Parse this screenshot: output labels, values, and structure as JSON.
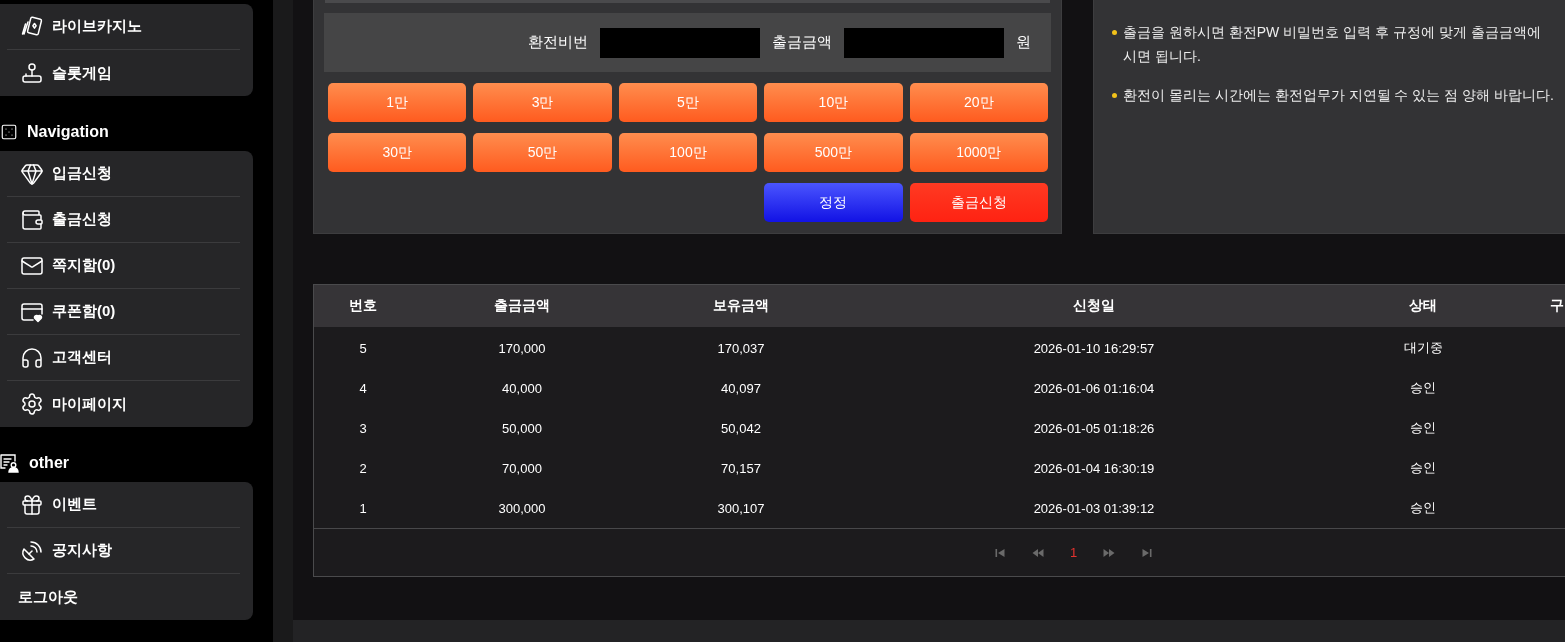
{
  "sidebar": {
    "sections": [
      {
        "items": [
          "라이브카지노",
          "슬롯게임"
        ]
      },
      {
        "title": "Navigation",
        "items": [
          "입금신청",
          "출금신청",
          "쪽지함(0)",
          "쿠폰함(0)",
          "고객센터",
          "마이페이지"
        ]
      },
      {
        "title": "other",
        "items": [
          "이벤트",
          "공지사항",
          "로그아웃"
        ]
      }
    ]
  },
  "withdraw_form": {
    "fields": [
      {
        "label": "환전비번"
      },
      {
        "label": "출금금액",
        "unit": "원"
      }
    ],
    "amount_buttons": [
      "1만",
      "3만",
      "5만",
      "10만",
      "20만",
      "30만",
      "50만",
      "100만",
      "500만",
      "1000만"
    ],
    "actions": [
      {
        "label": "정정",
        "kind": "reset"
      },
      {
        "label": "출금신청",
        "kind": "submit"
      }
    ]
  },
  "notices": [
    "출금을 원하시면 환전PW 비밀번호 입력 후 규정에 맞게 출금금액에\n시면 됩니다.",
    "환전이 몰리는 시간에는 환전업무가 지연될 수 있는 점 양해 바랍니다."
  ],
  "history_table": {
    "columns": [
      "번호",
      "출금금액",
      "보유금액",
      "신청일",
      "상태",
      "구"
    ],
    "rows": [
      [
        "5",
        "170,000",
        "170,037",
        "2026-01-10 16:29:57",
        "대기중"
      ],
      [
        "4",
        "40,000",
        "40,097",
        "2026-01-06 01:16:04",
        "승인"
      ],
      [
        "3",
        "50,000",
        "50,042",
        "2026-01-05 01:18:26",
        "승인"
      ],
      [
        "2",
        "70,000",
        "70,157",
        "2026-01-04 16:30:19",
        "승인"
      ],
      [
        "1",
        "300,000",
        "300,107",
        "2026-01-03 01:39:12",
        "승인"
      ]
    ],
    "pagination": {
      "pages": [
        {
          "label": "1",
          "selected": true
        }
      ]
    }
  }
}
